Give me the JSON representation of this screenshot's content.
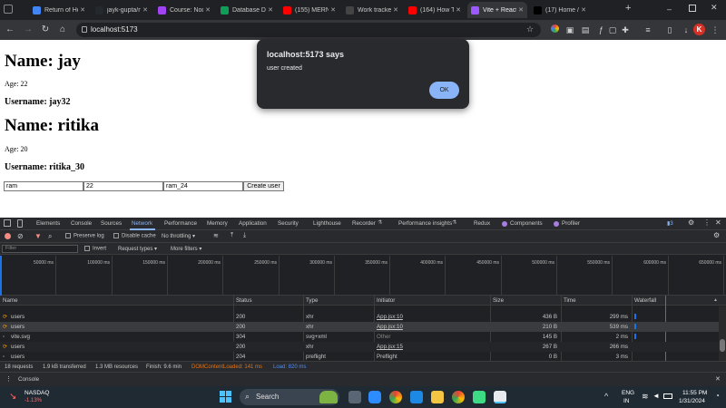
{
  "browser": {
    "tabs": [
      {
        "label": "Return of Ho",
        "color": "#4285f4",
        "active": false
      },
      {
        "label": "jayk-gupta/n",
        "color": "#24292e",
        "active": false
      },
      {
        "label": "Course: Node",
        "color": "#a142f4",
        "active": false
      },
      {
        "label": "Database De",
        "color": "#0f9d58",
        "active": false
      },
      {
        "label": "(155) MERN",
        "color": "#ff0000",
        "active": false
      },
      {
        "label": "Work tracker",
        "color": "#444444",
        "active": false
      },
      {
        "label": "(164) How To",
        "color": "#ff0000",
        "active": false
      },
      {
        "label": "Vite + React",
        "color": "#9b59ff",
        "active": true
      },
      {
        "label": "(17) Home /",
        "color": "#000000",
        "active": false
      }
    ],
    "new_tab": "+",
    "url": "localhost:5173",
    "profile_initial": "K"
  },
  "page": {
    "users": [
      {
        "name_heading": "Name: jay",
        "age": "Age: 22",
        "username_heading": "Username: jay32"
      },
      {
        "name_heading": "Name: ritika",
        "age": "Age: 20",
        "username_heading": "Username: ritika_30"
      }
    ],
    "form": {
      "name_value": "ram",
      "age_value": "22",
      "username_value": "ram_24",
      "submit_label": "Create user"
    }
  },
  "alert": {
    "title": "localhost:5173 says",
    "message": "user created",
    "ok_label": "OK"
  },
  "devtools": {
    "tabs": [
      "Elements",
      "Console",
      "Sources",
      "Network",
      "Performance",
      "Memory",
      "Application",
      "Security",
      "Lighthouse",
      "Recorder",
      "Performance insights",
      "Redux",
      "Components",
      "Profiler"
    ],
    "active_tab": "Network",
    "issues_count": "3",
    "network_toolbar": {
      "preserve_log": "Preserve log",
      "disable_cache": "Disable cache",
      "throttling": "No throttling"
    },
    "filter": {
      "placeholder": "Filter",
      "invert": "Invert",
      "request_types": "Request types",
      "more_filters": "More filters"
    },
    "timeline_ticks": [
      "50000 ms",
      "100000 ms",
      "150000 ms",
      "200000 ms",
      "250000 ms",
      "300000 ms",
      "350000 ms",
      "400000 ms",
      "450000 ms",
      "500000 ms",
      "550000 ms",
      "600000 ms",
      "650000 ms"
    ],
    "columns": [
      "Name",
      "Status",
      "Type",
      "Initiator",
      "Size",
      "Time",
      "Waterfall"
    ],
    "rows": [
      {
        "name": "users",
        "status": "200",
        "type": "xhr",
        "initiator": "App.jsx:10",
        "size": "436 B",
        "time": "299 ms"
      },
      {
        "name": "users",
        "status": "200",
        "type": "xhr",
        "initiator": "App.jsx:10",
        "size": "210 B",
        "time": "539 ms"
      },
      {
        "name": "vite.svg",
        "status": "304",
        "type": "svg+xml",
        "initiator": "Other",
        "size": "145 B",
        "time": "2 ms"
      },
      {
        "name": "users",
        "status": "200",
        "type": "xhr",
        "initiator": "App.jsx:15",
        "size": "267 B",
        "time": "266 ms"
      },
      {
        "name": "users",
        "status": "204",
        "type": "preflight",
        "initiator": "Preflight",
        "size": "0 B",
        "time": "3 ms"
      }
    ],
    "status_bar": {
      "requests": "18 requests",
      "transferred": "1.9 kB transferred",
      "resources": "1.3 MB resources",
      "finish": "Finish: 9.6 min",
      "dcl": "DOMContentLoaded: 141 ms",
      "load": "Load: 820 ms"
    },
    "drawer_tab": "Console"
  },
  "taskbar": {
    "stock_name": "NASDAQ",
    "stock_change": "-1.13%",
    "search_label": "Search",
    "lang_top": "ENG",
    "lang_bottom": "IN",
    "time": "11:55 PM",
    "date": "1/31/2024"
  },
  "colors": {
    "accent": "#8ab4f8",
    "load": "#4c8dff",
    "dcl": "#e8710a",
    "negative": "#ff6b6b"
  }
}
